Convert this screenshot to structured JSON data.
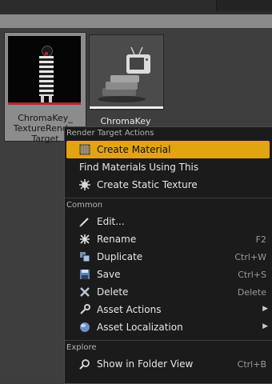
{
  "assets": {
    "render_target": {
      "name_line1": "ChromaKey_",
      "name_line2": "TextureRender",
      "name_line3": "Target"
    },
    "material": {
      "name": "ChromaKey"
    }
  },
  "context_menu": {
    "section_render_target": "Render Target Actions",
    "create_material": "Create Material",
    "find_materials": "Find Materials Using This",
    "create_static_texture": "Create Static Texture",
    "section_common": "Common",
    "edit": "Edit...",
    "rename": "Rename",
    "rename_shortcut": "F2",
    "duplicate": "Duplicate",
    "duplicate_shortcut": "Ctrl+W",
    "save": "Save",
    "save_shortcut": "Ctrl+S",
    "delete": "Delete",
    "delete_shortcut": "Delete",
    "asset_actions": "Asset Actions",
    "asset_localization": "Asset Localization",
    "section_explore": "Explore",
    "show_in_folder": "Show in Folder View",
    "show_in_folder_shortcut": "Ctrl+B"
  },
  "colors": {
    "highlight": "#e2a40f",
    "menu_bg": "#1b1b1b",
    "selection_tile": "#8c8c8c"
  }
}
